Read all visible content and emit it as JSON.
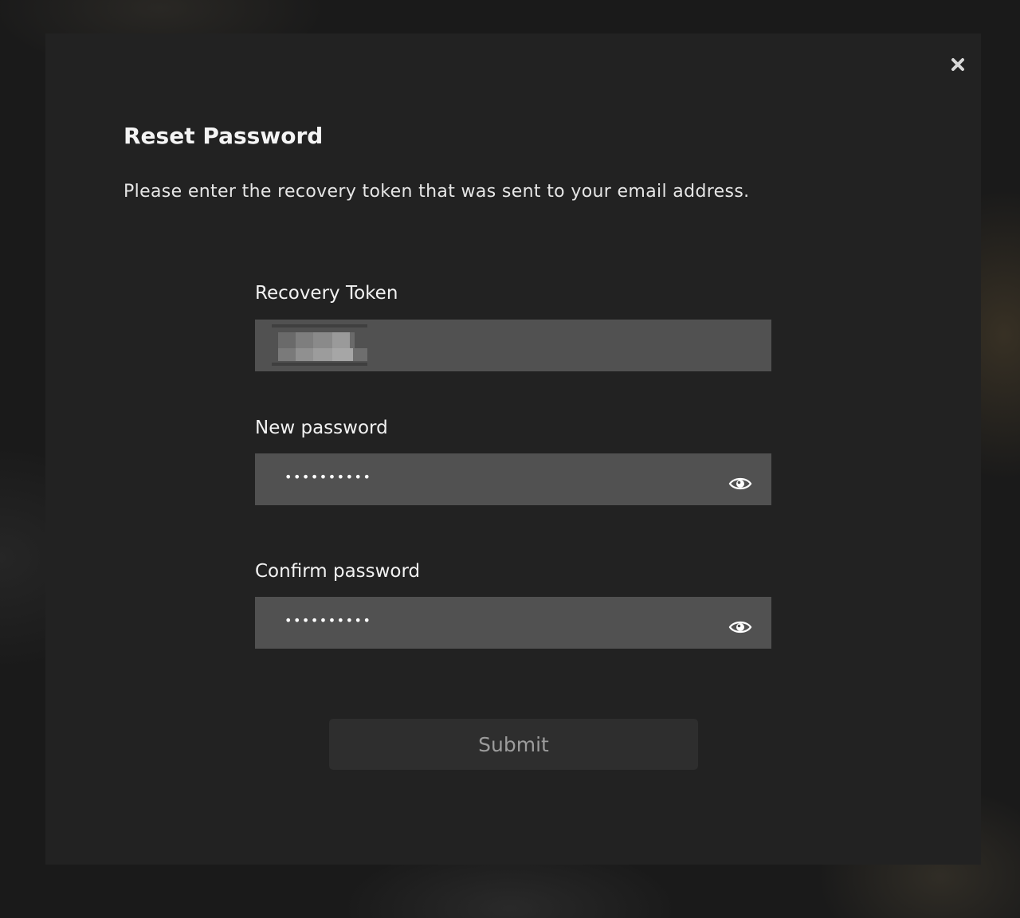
{
  "dialog": {
    "title": "Reset Password",
    "description": "Please enter the recovery token that was sent to your email address.",
    "close_icon": "close-icon"
  },
  "fields": {
    "token": {
      "label": "Recovery Token",
      "value_note": "redacted"
    },
    "new_password": {
      "label": "New password",
      "value": "••••••••••",
      "toggle_icon": "eye-icon"
    },
    "confirm_password": {
      "label": "Confirm password",
      "value": "••••••••••",
      "toggle_icon": "eye-icon"
    }
  },
  "submit": {
    "label": "Submit"
  },
  "colors": {
    "modal_bg": "#222222",
    "input_bg": "#515151",
    "button_bg": "#2e2e2e",
    "button_text": "#9c9c9c"
  }
}
